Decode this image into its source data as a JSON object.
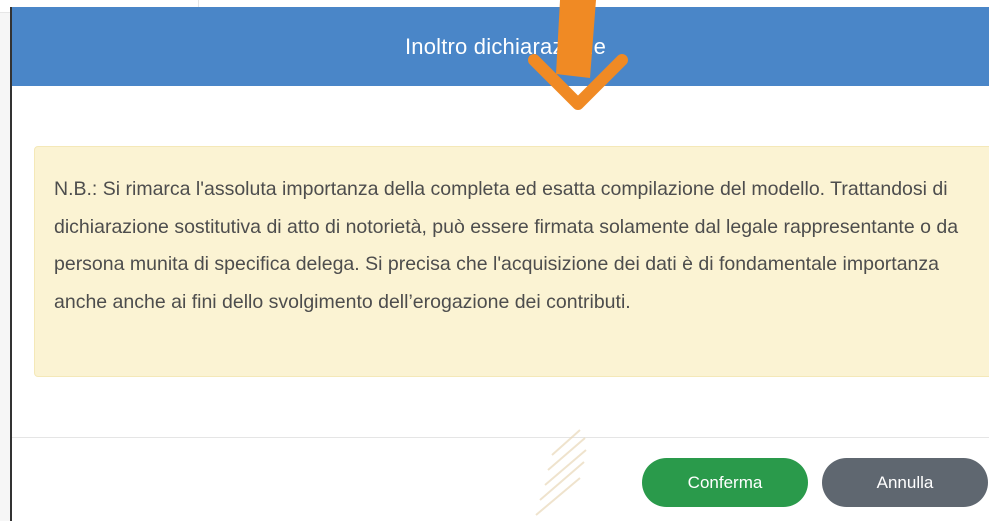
{
  "modal": {
    "title": "Inoltro dichiarazione",
    "note": "N.B.: Si rimarca l'assoluta importanza della completa ed esatta compilazione del modello. Trattandosi di dichiarazione sostitutiva di atto di notorietà, può essere firmata solamente dal legale rappresentante o da persona munita di specifica delega. Si precisa che l'acquisizione dei dati è di fondamentale importanza anche anche ai fini dello svolgimento dell’erogazione dei contributi.",
    "confirm_label": "Conferma",
    "cancel_label": "Annulla"
  },
  "colors": {
    "header": "#4a86c8",
    "note_background": "#fbf3d3",
    "confirm_button": "#2a9a4b",
    "cancel_button": "#5f6770",
    "annotation_arrow": "#f08a24"
  },
  "icons": {
    "annotation": "arrow-down-icon"
  }
}
